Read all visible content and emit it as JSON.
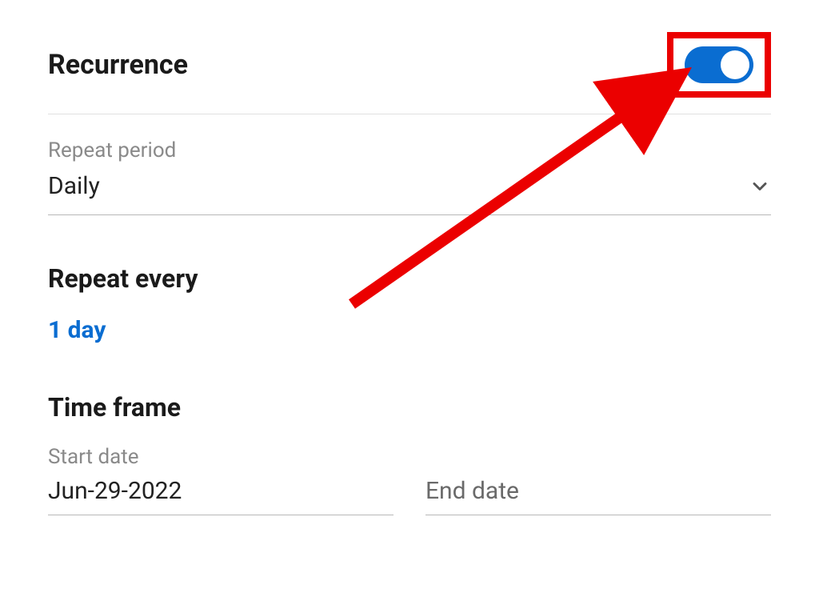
{
  "recurrence": {
    "title": "Recurrence",
    "repeat_period_label": "Repeat period",
    "repeat_period_value": "Daily"
  },
  "repeat_every": {
    "title": "Repeat every",
    "value": "1 day"
  },
  "time_frame": {
    "title": "Time frame",
    "start_date_label": "Start date",
    "start_date_value": "Jun-29-2022",
    "end_date_label": "End date"
  }
}
